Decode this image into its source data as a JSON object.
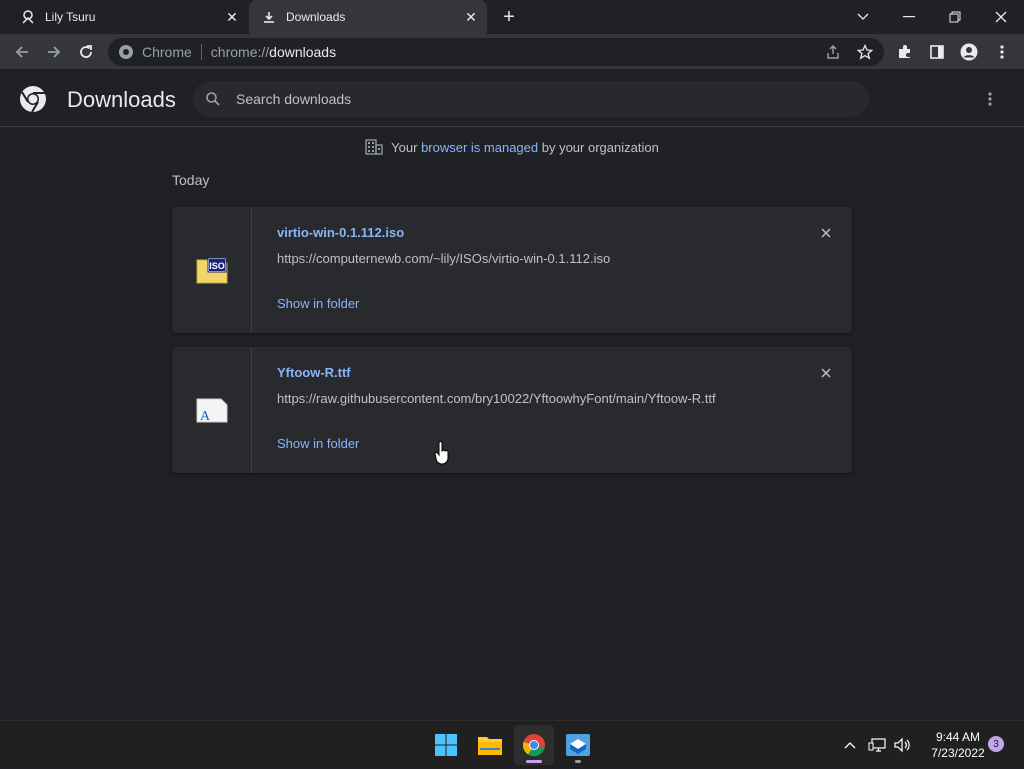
{
  "tabs": [
    {
      "title": "Lily Tsuru",
      "icon": "profile-favicon-icon"
    },
    {
      "title": "Downloads",
      "icon": "download-icon"
    }
  ],
  "omnibox": {
    "site_chip": "Chrome",
    "url_scheme": "chrome://",
    "url_host": "downloads"
  },
  "downloads_page": {
    "title": "Downloads",
    "search_placeholder": "Search downloads",
    "managed_notice": {
      "prefix": "Your ",
      "link": "browser is managed",
      "suffix": " by your organization"
    },
    "date_header": "Today",
    "items": [
      {
        "filename": "virtio-win-0.1.112.iso",
        "url": "https://computernewb.com/~lily/ISOs/virtio-win-0.1.112.iso",
        "action": "Show in folder",
        "icon": "iso-file-icon"
      },
      {
        "filename": "Yftoow-R.ttf",
        "url": "https://raw.githubusercontent.com/bry10022/YftoowhyFont/main/Yftoow-R.ttf",
        "action": "Show in folder",
        "icon": "font-file-icon"
      }
    ]
  },
  "taskbar": {
    "apps": [
      "start-icon",
      "file-explorer-icon",
      "chrome-icon",
      "virtualbox-icon"
    ],
    "time": "9:44 AM",
    "date": "7/23/2022",
    "notification_count": "3"
  },
  "colors": {
    "accent_link": "#8ab4f8",
    "page_bg": "#202124",
    "card_bg": "#292a2d"
  }
}
